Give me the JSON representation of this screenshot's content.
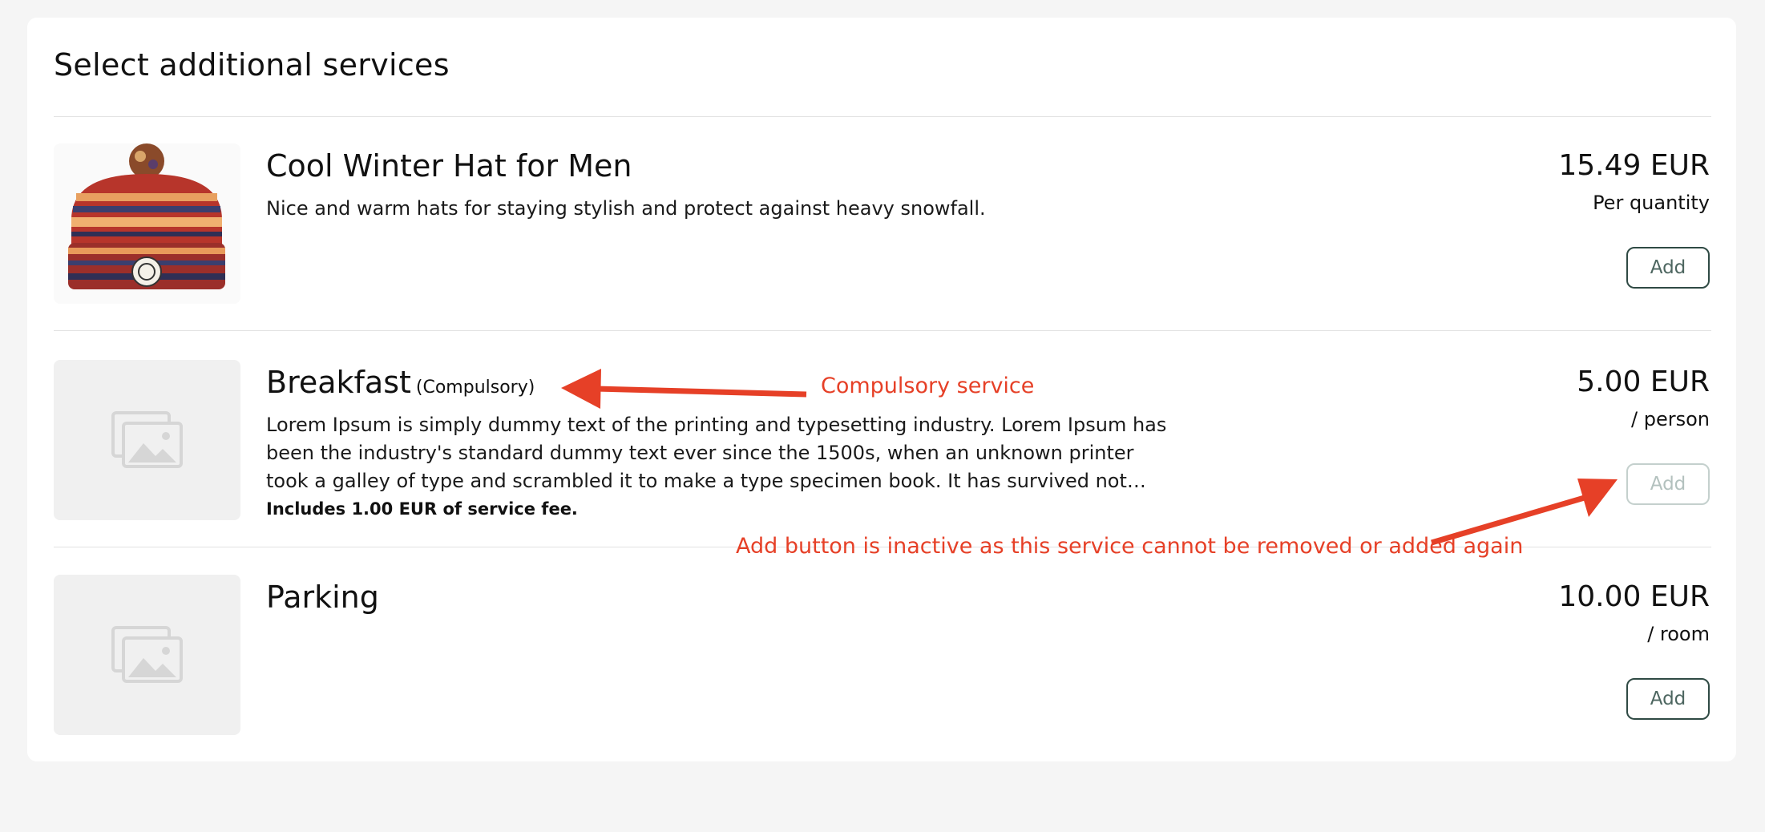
{
  "page": {
    "title": "Select additional services"
  },
  "services": [
    {
      "name": "Cool Winter Hat for Men",
      "tag": "",
      "description": "Nice and warm hats for staying stylish and protect against heavy snowfall.",
      "fee_note": "",
      "price": "15.49 EUR",
      "unit": "Per quantity",
      "button_label": "Add",
      "button_enabled": true,
      "image": "winter-hat-photo"
    },
    {
      "name": "Breakfast",
      "tag": "(Compulsory)",
      "description": "Lorem Ipsum is simply dummy text of the printing and typesetting industry. Lorem Ipsum has been the industry's standard dummy text ever since the 1500s, when an unknown printer took a galley of type and scrambled it to make a type specimen book. It has survived not only five centuries, but also the leap into electronic typesetting, remaining essentially unchanged.",
      "fee_note": "Includes 1.00 EUR of service fee.",
      "price": "5.00 EUR",
      "unit": "/ person",
      "button_label": "Add",
      "button_enabled": false,
      "image": "image-placeholder-icon"
    },
    {
      "name": "Parking",
      "tag": "",
      "description": "",
      "fee_note": "",
      "price": "10.00 EUR",
      "unit": "/ room",
      "button_label": "Add",
      "button_enabled": true,
      "image": "image-placeholder-icon"
    }
  ],
  "annotations": {
    "compulsory": "Compulsory service",
    "inactive": "Add button is inactive as this service cannot be removed or added again"
  },
  "colors": {
    "annotation": "#e64027",
    "button_border": "#2f4a44",
    "button_disabled": "#c4d0cd",
    "background": "#f5f5f5",
    "card": "#ffffff"
  }
}
